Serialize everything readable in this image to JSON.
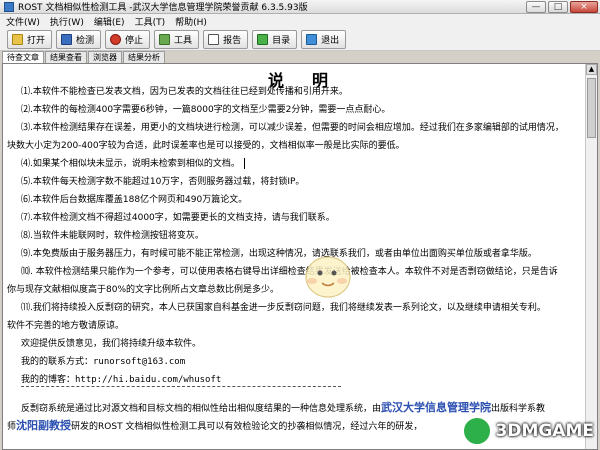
{
  "window": {
    "title": "ROST 文档相似性检测工具 -武汉大学信息管理学院荣誉贡献 6.3.5.93版",
    "minimize": "—",
    "maximize": "□",
    "close": "×"
  },
  "menu": [
    "文件(W)",
    "执行(W)",
    "编辑(E)",
    "工具(T)",
    "帮助(H)"
  ],
  "toolbar": [
    {
      "label": "打开",
      "icon": "folder-open-icon"
    },
    {
      "label": "检测",
      "icon": "check-icon"
    },
    {
      "label": "停止",
      "icon": "stop-icon"
    },
    {
      "label": "工具",
      "icon": "tools-icon"
    },
    {
      "label": "报告",
      "icon": "report-icon"
    },
    {
      "label": "目录",
      "icon": "directory-icon"
    },
    {
      "label": "退出",
      "icon": "exit-icon"
    }
  ],
  "tabs": [
    "待查文章",
    "结果查看",
    "浏览器",
    "结果分析"
  ],
  "doc": {
    "title": "说　明",
    "lines": [
      "⑴.本软件不能检查已发表文档，因为已发表的文档往往已经到处传播和引用开来。",
      "⑵.本软件的每检测400字需要6秒钟，一篇8000字的文档至少需要2分钟，需要一点点耐心。",
      "⑶.本软件检测结果存在误差，用更小的文档块进行检测，可以减少误差，但需要的时间会相应增加。经过我们在多家编辑部的试用情况，",
      "块数大小定为200-400字较为合适，此时误差率也是可以接受的，文档相似率一般是比实际的要低。",
      "⑷.如果某个相似块未显示，说明未检索到相似的文档。",
      "⑸.本软件每天检测字数不能超过10万字，否则服务器过载，将封锁IP。",
      "⑹.本软件后台数据库覆盖188亿个网页和490万篇论文。",
      "⑺.本软件检测文档不得超过4000字，如需要更长的文档支持，请与我们联系。",
      "⑻.当软件未能联网时，软件检测按钮将变灰。",
      "⑼.本免费版由于服务器压力，有时候可能不能正常检测，出现这种情况，请选联系我们，或者由单位出面购买单位版或者拿华版。",
      "⑽. 本软件检测结果只能作为一个参考，可以使用表格右键导出详细检查结果发送给被检查本人。本软件不对是否剽窃做结论，只是告诉",
      "你与现存文献相似度高于80%的文字比例所占文章总数比例是多少。",
      "⑾.我们将持续投入反剽窃的研究，本人已获国家自科基金进一步反剽窃问题，我们将继续发表一系列论文，以及继续申请相关专利。",
      "软件不完善的地方敬请原谅。",
      "欢迎提供反馈意见，我们将持续升级本软件。",
      "我的的联系方式：runorsoft@163.com",
      "我的的博客：http://hi.baidu.com/whusoft",
      "反剽窃系统是通过比对源文档和目标文档的相似性给出相似度结果的一种信息处理系统，由",
      "研发的ROST 文档相似性检测工具可以有效检验论文的抄袭相似情况，经过六年的研发，"
    ],
    "highlight_whu": "武汉大学信息管理学院",
    "tail_line17": "出版科学系教",
    "prefix_line18": "师",
    "highlight_shenyang": "沈阳副教授"
  },
  "watermark": "3DMGAME",
  "colors": {
    "accent_blue": "#2a4fb0",
    "close_red": "#c8473a"
  }
}
